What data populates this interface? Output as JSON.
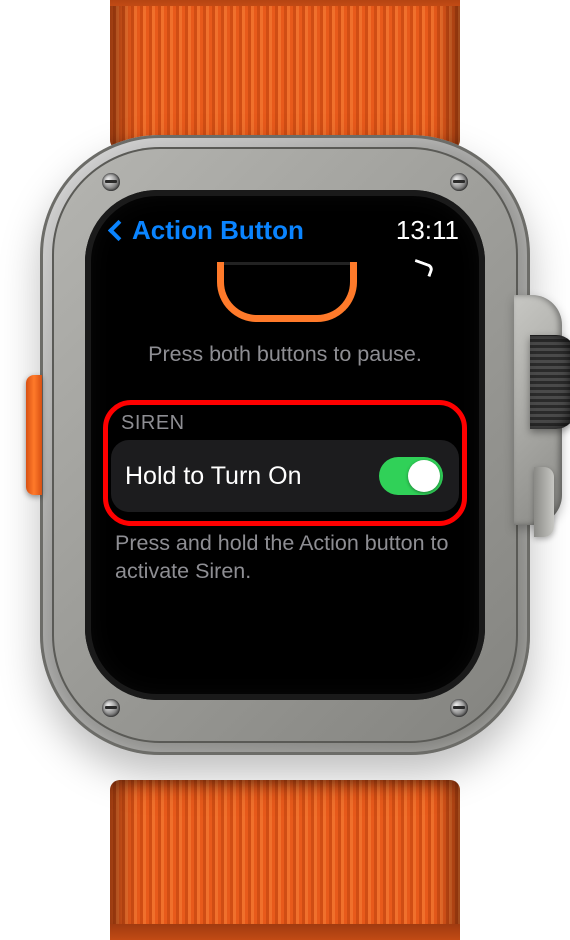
{
  "header": {
    "back_label": "Action Button",
    "time": "13:11"
  },
  "hint_pause": "Press both buttons to pause.",
  "siren": {
    "section_label": "SIREN",
    "cell_label": "Hold to Turn On",
    "toggle_on": true,
    "footer": "Press and hold the Action button to activate Siren."
  }
}
